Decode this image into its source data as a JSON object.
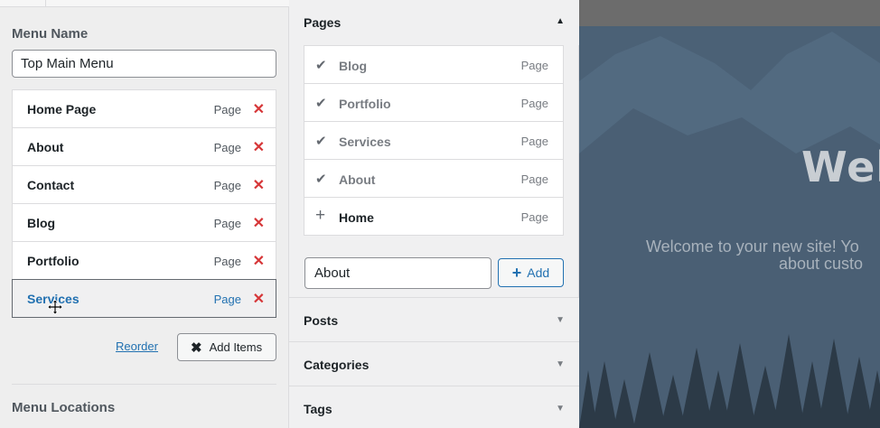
{
  "menu": {
    "name_label": "Menu Name",
    "name_value": "Top Main Menu",
    "items": [
      {
        "title": "Home Page",
        "type": "Page"
      },
      {
        "title": "About",
        "type": "Page"
      },
      {
        "title": "Contact",
        "type": "Page"
      },
      {
        "title": "Blog",
        "type": "Page"
      },
      {
        "title": "Portfolio",
        "type": "Page"
      },
      {
        "title": "Services",
        "type": "Page"
      }
    ],
    "remove_icon": "✕",
    "reorder_label": "Reorder",
    "add_items_label": "Add Items",
    "locations_label": "Menu Locations"
  },
  "pages_panel": {
    "title": "Pages",
    "caret": "▲",
    "items": [
      {
        "title": "Blog",
        "type": "Page",
        "icon": "✔"
      },
      {
        "title": "Portfolio",
        "type": "Page",
        "icon": "✔"
      },
      {
        "title": "Services",
        "type": "Page",
        "icon": "✔"
      },
      {
        "title": "About",
        "type": "Page",
        "icon": "✔"
      },
      {
        "title": "Home",
        "type": "Page",
        "icon": "+"
      }
    ],
    "new_page_value": "About",
    "add_button_label": "Add"
  },
  "sections": [
    {
      "title": "Posts",
      "caret": "▼"
    },
    {
      "title": "Categories",
      "caret": "▼"
    },
    {
      "title": "Tags",
      "caret": "▼"
    }
  ],
  "preview": {
    "heading": "Welc",
    "line1": "Welcome to your new site! Yo",
    "line2": "about custo"
  },
  "colors": {
    "accent": "#2271b1",
    "remove": "#d63638",
    "preview_bg": "#4a5f73"
  }
}
